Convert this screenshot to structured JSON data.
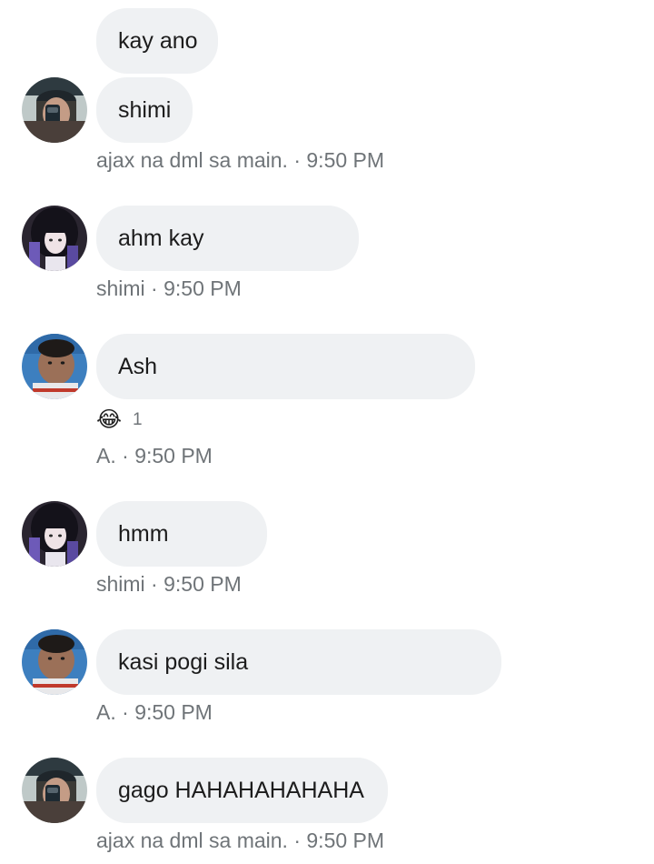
{
  "messages": [
    {
      "text": "kay ano"
    },
    {
      "text": "shimi",
      "sender": "ajax na dml sa main.",
      "time": "9:50 PM"
    },
    {
      "text": "ahm kay",
      "sender": "shimi",
      "time": "9:50 PM"
    },
    {
      "text": "Ash",
      "sender": "A.",
      "time": "9:50 PM",
      "reaction": {
        "emoji": "😂",
        "count": "1"
      }
    },
    {
      "text": "hmm",
      "sender": "shimi",
      "time": "9:50 PM"
    },
    {
      "text": "kasi pogi sila",
      "sender": "A.",
      "time": "9:50 PM"
    },
    {
      "text": "gago HAHAHAHAHAHA",
      "sender": "ajax na dml sa main.",
      "time": "9:50 PM"
    }
  ],
  "separator": " · ",
  "avatars": {
    "ajax": "avatar-mirror-selfie",
    "shimi": "avatar-dark-hair",
    "a": "avatar-child-face"
  },
  "colors": {
    "bubble": "#eff1f3",
    "meta_text": "#6f7478",
    "message_text": "#1c1c1c"
  }
}
